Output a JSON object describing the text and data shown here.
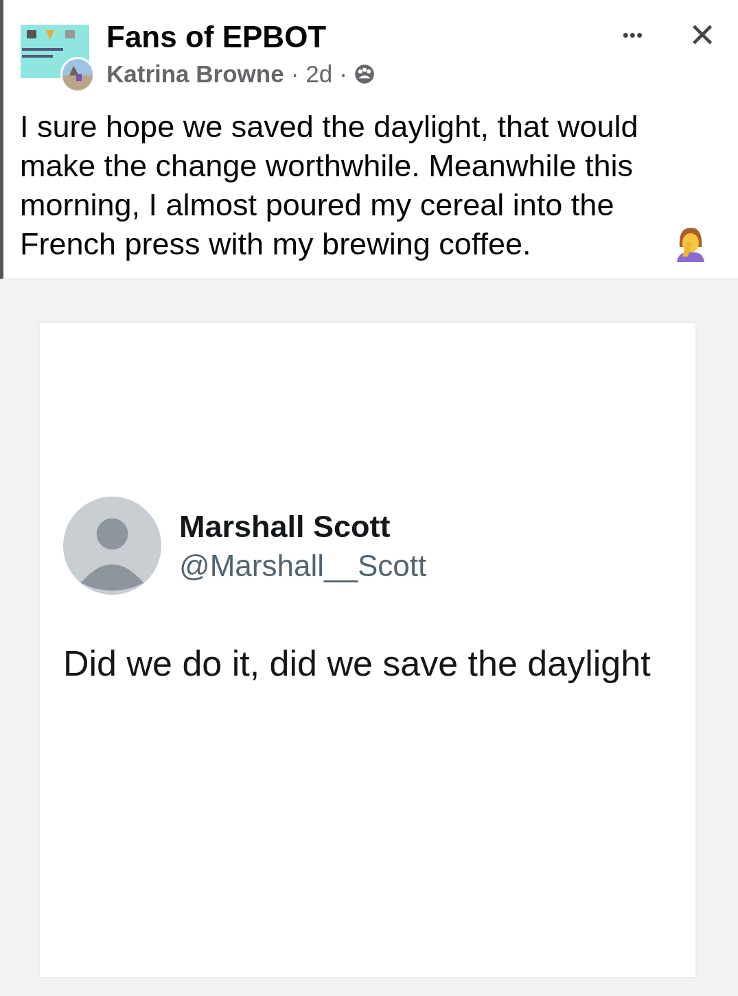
{
  "post": {
    "group_name": "Fans of EPBOT",
    "author": "Katrina Browne",
    "separator_1": "·",
    "time": "2d",
    "separator_2": "·",
    "more_button": "•••",
    "close_button": "✕",
    "text": "I sure hope we saved the daylight, that would make the change worthwhile. Meanwhile this morning, I almost poured my cereal into the French press with my brewing coffee."
  },
  "tweet": {
    "name": "Marshall Scott",
    "handle": "@Marshall__Scott",
    "text": "Did we do it, did we save the daylight"
  }
}
